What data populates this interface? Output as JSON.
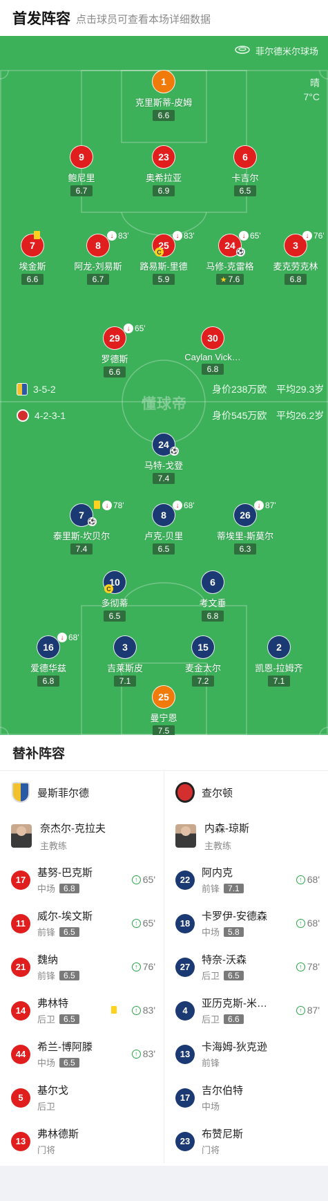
{
  "header": {
    "title": "首发阵容",
    "subtitle": "点击球员可查看本场详细数据"
  },
  "venue": {
    "name": "菲尔德米尔球场",
    "icon": "stadium-icon"
  },
  "weather": {
    "condition": "晴",
    "temperature": "7°C"
  },
  "watermark": "懂球帝",
  "home_team": {
    "name": "曼斯菲尔德",
    "formation": "3-5-2",
    "value": "身价238万欧",
    "avg_age": "平均29.3岁"
  },
  "away_team": {
    "name": "查尔顿",
    "formation": "4-2-3-1",
    "value": "身价545万欧",
    "avg_age": "平均26.2岁"
  },
  "home_lineup": [
    {
      "number": "1",
      "name": "克里斯蒂-皮姆",
      "rating": "6.6"
    },
    {
      "number": "9",
      "name": "鲍尼里",
      "rating": "6.7"
    },
    {
      "number": "23",
      "name": "奥希拉亚",
      "rating": "6.9"
    },
    {
      "number": "6",
      "name": "卡吉尔",
      "rating": "6.5"
    },
    {
      "number": "7",
      "name": "埃金斯",
      "rating": "6.6"
    },
    {
      "number": "8",
      "name": "阿龙-刘易斯",
      "rating": "6.7",
      "sub_minute": "83'"
    },
    {
      "number": "25",
      "name": "路易斯-里德",
      "rating": "5.9",
      "sub_minute": "83'"
    },
    {
      "number": "24",
      "name": "马修-克雷格",
      "rating": "7.6",
      "sub_minute": "65'"
    },
    {
      "number": "3",
      "name": "麦克劳克林",
      "rating": "6.8",
      "sub_minute": "76'"
    },
    {
      "number": "29",
      "name": "罗德斯",
      "rating": "6.6",
      "sub_minute": "65'"
    },
    {
      "number": "30",
      "name": "Caylan Vick…",
      "rating": "6.8"
    }
  ],
  "away_lineup": [
    {
      "number": "24",
      "name": "马特-戈登",
      "rating": "7.4"
    },
    {
      "number": "7",
      "name": "泰里斯-坎贝尔",
      "rating": "7.4",
      "sub_minute": "78'"
    },
    {
      "number": "8",
      "name": "卢克-贝里",
      "rating": "6.5",
      "sub_minute": "68'"
    },
    {
      "number": "26",
      "name": "蒂埃里-斯莫尔",
      "rating": "6.3",
      "sub_minute": "87'"
    },
    {
      "number": "10",
      "name": "多彻蒂",
      "rating": "6.5"
    },
    {
      "number": "6",
      "name": "考文垂",
      "rating": "6.8"
    },
    {
      "number": "16",
      "name": "爱德华兹",
      "rating": "6.8",
      "sub_minute": "68'"
    },
    {
      "number": "3",
      "name": "吉莱斯皮",
      "rating": "7.1"
    },
    {
      "number": "15",
      "name": "麦金太尔",
      "rating": "7.2"
    },
    {
      "number": "2",
      "name": "凯恩-拉姆齐",
      "rating": "7.1"
    },
    {
      "number": "25",
      "name": "曼宁恩",
      "rating": "7.5"
    }
  ],
  "subs": {
    "title": "替补阵容",
    "home": {
      "team_name": "曼斯菲尔德",
      "coach": {
        "name": "奈杰尔-克拉夫",
        "role": "主教练"
      },
      "players": [
        {
          "number": "17",
          "name": "基努-巴克斯",
          "position": "中场",
          "rating": "6.8",
          "in_minute": "65'"
        },
        {
          "number": "11",
          "name": "威尔-埃文斯",
          "position": "前锋",
          "rating": "6.5",
          "in_minute": "65'"
        },
        {
          "number": "21",
          "name": "魏纳",
          "position": "前锋",
          "rating": "6.5",
          "in_minute": "76'"
        },
        {
          "number": "14",
          "name": "弗林特",
          "position": "后卫",
          "rating": "6.5",
          "in_minute": "83'",
          "yellow_card": true
        },
        {
          "number": "44",
          "name": "希兰-博阿滕",
          "position": "中场",
          "rating": "6.5",
          "in_minute": "83'"
        },
        {
          "number": "5",
          "name": "基尔戈",
          "position": "后卫"
        },
        {
          "number": "13",
          "name": "弗林德斯",
          "position": "门将"
        }
      ]
    },
    "away": {
      "team_name": "查尔顿",
      "coach": {
        "name": "内森-琼斯",
        "role": "主教练"
      },
      "players": [
        {
          "number": "22",
          "name": "阿内克",
          "position": "前锋",
          "rating": "7.1",
          "in_minute": "68'"
        },
        {
          "number": "18",
          "name": "卡罗伊-安德森",
          "position": "中场",
          "rating": "5.8",
          "in_minute": "68'"
        },
        {
          "number": "27",
          "name": "特奈-沃森",
          "position": "后卫",
          "rating": "6.5",
          "in_minute": "78'"
        },
        {
          "number": "4",
          "name": "亚历克斯-米…",
          "position": "后卫",
          "rating": "6.6",
          "in_minute": "87'"
        },
        {
          "number": "13",
          "name": "卡海姆-狄克逊",
          "position": "前锋"
        },
        {
          "number": "17",
          "name": "吉尔伯特",
          "position": "中场"
        },
        {
          "number": "23",
          "name": "布赞尼斯",
          "position": "门将"
        }
      ]
    }
  }
}
